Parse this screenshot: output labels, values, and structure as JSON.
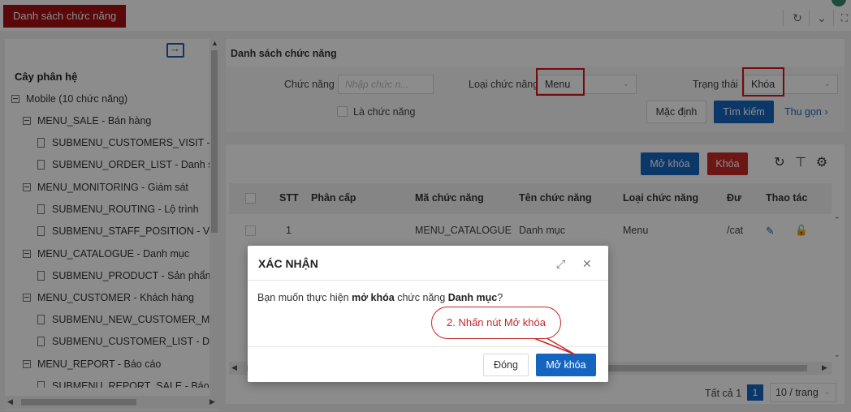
{
  "topbar": {
    "active_tab": "Danh sách chức năng",
    "refresh_icon": "refresh-icon",
    "dropdown_icon": "chevron-down-icon",
    "fullscreen_icon": "fullscreen-icon"
  },
  "tree": {
    "title": "Cây phân hệ",
    "items": [
      {
        "label": "Mobile (10 chức năng)",
        "level": 0,
        "type": "folder"
      },
      {
        "label": "MENU_SALE - Bán hàng",
        "level": 1,
        "type": "folder"
      },
      {
        "label": "SUBMENU_CUSTOMERS_VISIT - Khách hàng viếng thăm",
        "level": 2,
        "type": "leaf"
      },
      {
        "label": "SUBMENU_ORDER_LIST - Danh sách đơn hàng",
        "level": 2,
        "type": "leaf"
      },
      {
        "label": "MENU_MONITORING - Giám sát",
        "level": 1,
        "type": "folder"
      },
      {
        "label": "SUBMENU_ROUTING - Lộ trình",
        "level": 2,
        "type": "leaf"
      },
      {
        "label": "SUBMENU_STAFF_POSITION - Vị trí nhân viên",
        "level": 2,
        "type": "leaf"
      },
      {
        "label": "MENU_CATALOGUE - Danh mục",
        "level": 1,
        "type": "folder"
      },
      {
        "label": "SUBMENU_PRODUCT - Sản phẩm",
        "level": 2,
        "type": "leaf"
      },
      {
        "label": "MENU_CUSTOMER - Khách hàng",
        "level": 1,
        "type": "folder"
      },
      {
        "label": "SUBMENU_NEW_CUSTOMER_MGM - Khách hàng mới",
        "level": 2,
        "type": "leaf"
      },
      {
        "label": "SUBMENU_CUSTOMER_LIST - Danh sách khách hàng",
        "level": 2,
        "type": "leaf"
      },
      {
        "label": "MENU_REPORT - Báo cáo",
        "level": 1,
        "type": "folder"
      },
      {
        "label": "SUBMENU_REPORT_SALE - Báo cáo bán hàng",
        "level": 2,
        "type": "leaf"
      }
    ]
  },
  "filter": {
    "title": "Danh sách chức năng",
    "function_label": "Chức năng",
    "function_placeholder": "Nhập chức n...",
    "type_label": "Loại chức năng",
    "type_value": "Menu",
    "status_label": "Trạng thái",
    "status_value": "Khóa",
    "is_function_label": "Là chức năng",
    "default_btn": "Mặc định",
    "search_btn": "Tìm kiếm",
    "collapse_link": "Thu gọn"
  },
  "table": {
    "unlock_btn": "Mở khóa",
    "lock_btn": "Khóa",
    "columns": [
      "STT",
      "Phân cấp",
      "Mã chức năng",
      "Tên chức năng",
      "Loại chức năng",
      "Đư",
      "Thao tác"
    ],
    "rows": [
      {
        "stt": "1",
        "level": "",
        "code": "MENU_CATALOGUE",
        "name": "Danh mục",
        "type": "Menu",
        "path": "/cat"
      }
    ],
    "pager": {
      "total": "Tất cả 1",
      "page": "1",
      "page_size": "10 / trang"
    }
  },
  "dialog": {
    "title": "XÁC NHẬN",
    "msg_prefix": "Bạn muốn thực hiện ",
    "msg_action": "mở khóa",
    "msg_mid": " chức năng ",
    "msg_name": "Danh mục",
    "msg_suffix": "?",
    "close_btn": "Đóng",
    "confirm_btn": "Mở khóa"
  },
  "annotation": {
    "callout_text": "2. Nhấn nút Mở khóa",
    "color": "#c62828"
  },
  "colors": {
    "brand_red": "#a40f13",
    "primary_blue": "#1565c0",
    "danger_red": "#c62828"
  }
}
